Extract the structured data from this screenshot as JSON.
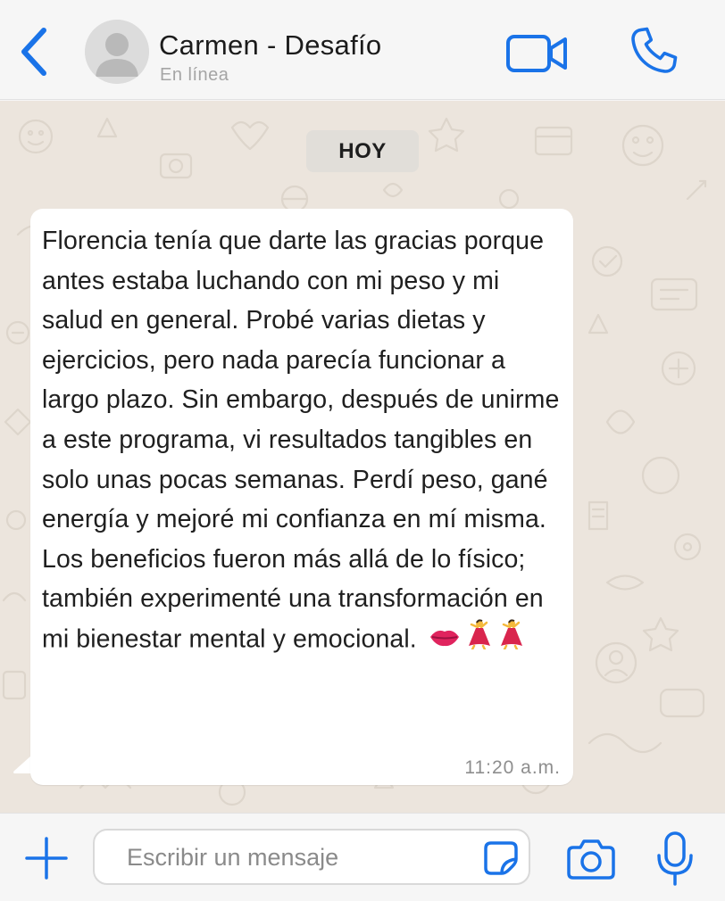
{
  "header": {
    "contact_name": "Carmen - Desafío",
    "status": "En línea",
    "back_icon": "chevron-left-icon",
    "video_icon": "video-camera-icon",
    "call_icon": "phone-icon"
  },
  "chat": {
    "date_label": "HOY",
    "messages": [
      {
        "direction": "incoming",
        "text": "Florencia tenía que darte las gracias porque antes estaba luchando con mi peso y mi salud en general. Probé varias dietas y ejercicios, pero nada parecía funcionar a largo plazo. Sin embargo, después de unirme a este programa, vi resultados tangibles en solo unas pocas semanas. Perdí peso, gané energía y mejoré mi confianza en mí misma. Los beneficios fueron más allá de lo físico; también experimenté una transformación en mi bienestar mental y emocional.",
        "emojis": [
          "lips",
          "dancer",
          "dancer"
        ],
        "time": "11:20 a.m."
      }
    ]
  },
  "composer": {
    "placeholder": "Escribir un mensaje",
    "value": "",
    "icons": [
      "plus-icon",
      "sticker-icon",
      "camera-icon",
      "microphone-icon"
    ]
  },
  "colors": {
    "accent": "#1a73e8",
    "chat_background": "#ece5dd",
    "bubble": "#ffffff",
    "bar_background": "#f6f6f6"
  }
}
